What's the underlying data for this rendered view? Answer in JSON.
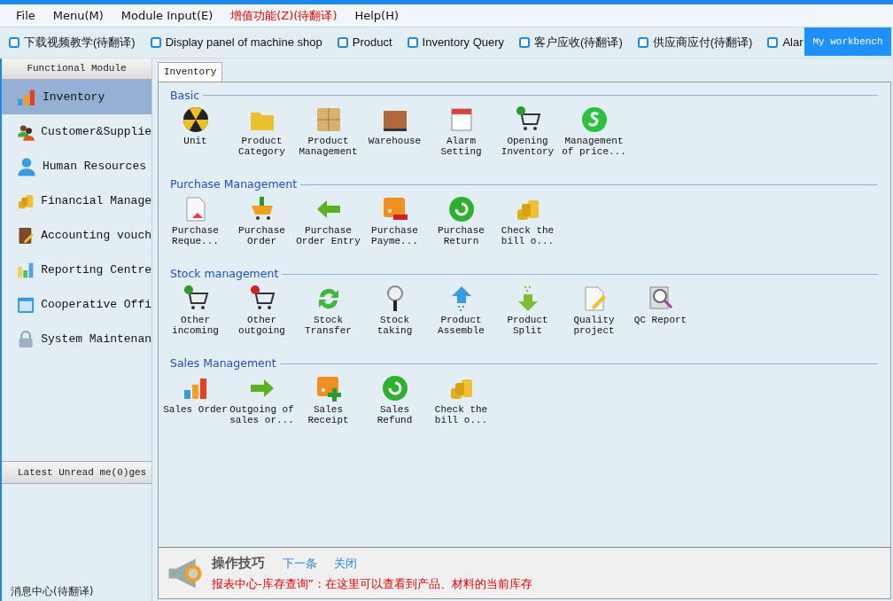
{
  "menu": [
    {
      "label": "File",
      "highlighted": false
    },
    {
      "label": "Menu(M)",
      "highlighted": false
    },
    {
      "label": "Module Input(E)",
      "highlighted": false
    },
    {
      "label": "增值功能(Z)(待翻译)",
      "highlighted": true
    },
    {
      "label": "Help(H)",
      "highlighted": false
    }
  ],
  "toolbar": [
    "下载视频教学(待翻译)",
    "Display panel of machine shop",
    "Product",
    "Inventory Query",
    "客户应收(待翻译)",
    "供应商应付(待翻译)",
    "Alar"
  ],
  "workbench_button": "My workbench",
  "sidebar": {
    "title": "Functional Module",
    "items": [
      {
        "label": "Inventory",
        "selected": true
      },
      {
        "label": "Customer&Supplie",
        "selected": false
      },
      {
        "label": "Human Resources",
        "selected": false
      },
      {
        "label": "Financial Manage",
        "selected": false
      },
      {
        "label": "Accounting vouch",
        "selected": false
      },
      {
        "label": "Reporting Centre",
        "selected": false
      },
      {
        "label": "Cooperative Offi",
        "selected": false
      },
      {
        "label": "System Maintenan",
        "selected": false
      }
    ],
    "messages_title": "Latest Unread me(0)ges",
    "footer": "消息中心(待翻译)"
  },
  "tabs": [
    {
      "label": "Inventory",
      "selected": true
    }
  ],
  "sections": [
    {
      "title": "Basic",
      "items": [
        "Unit",
        "Product Category",
        "Product Management",
        "Warehouse",
        "Alarm Setting",
        "Opening Inventory",
        "Management of price..."
      ]
    },
    {
      "title": "Purchase Management",
      "items": [
        "Purchase Reque...",
        "Purchase Order",
        "Purchase Order Entry",
        "Purchase Payme...",
        "Purchase Return",
        "Check the bill o..."
      ]
    },
    {
      "title": "Stock management",
      "items": [
        "Other incoming",
        "Other outgoing",
        "Stock Transfer",
        "Stock taking",
        "Product Assemble",
        "Product Split",
        "Quality project",
        "QC Report"
      ]
    },
    {
      "title": "Sales Management",
      "items": [
        "Sales Order",
        "Outgoing of sales or...",
        "Sales Receipt",
        "Sales Refund",
        "Check the bill o..."
      ]
    }
  ],
  "tips": {
    "title": "操作技巧",
    "next": "下一条",
    "close": "关闭",
    "message": "报表中心-库存查询”：在这里可以查看到产品、材料的当前库存"
  }
}
